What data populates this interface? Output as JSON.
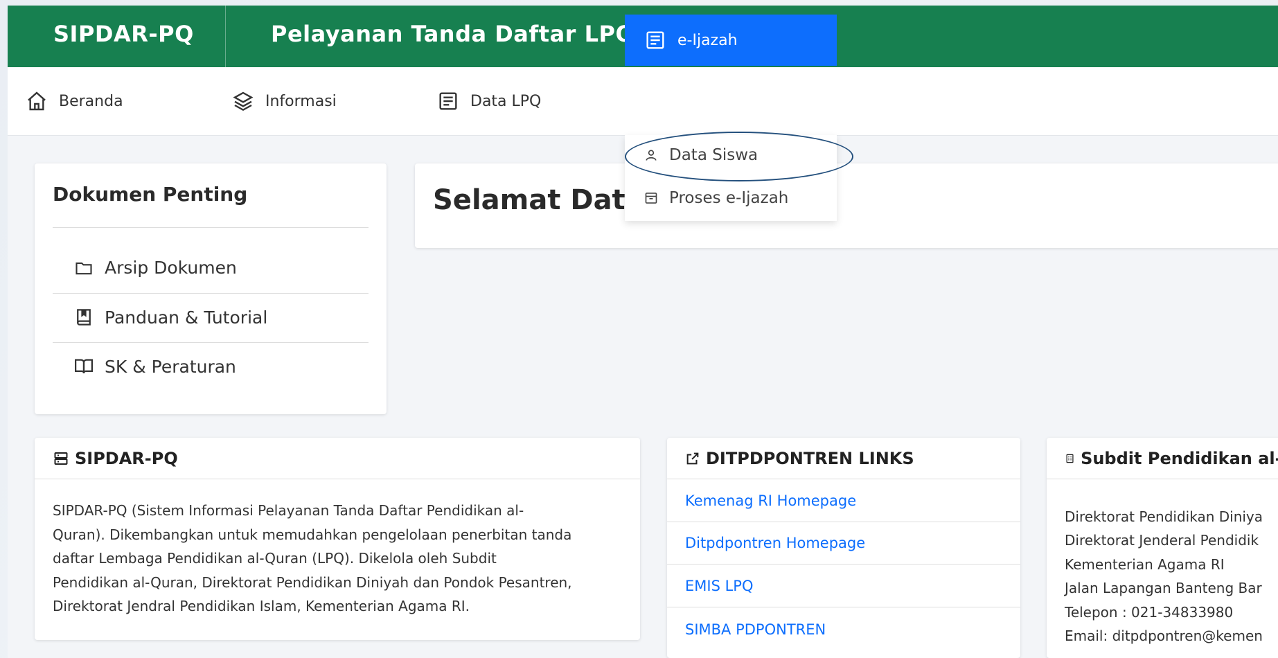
{
  "header": {
    "brand": "SIPDAR-PQ",
    "title": "Pelayanan Tanda Daftar LPQ"
  },
  "nav": {
    "beranda": "Beranda",
    "informasi": "Informasi",
    "data_lpq": "Data LPQ",
    "eijazah": "e-Ijazah"
  },
  "dropdown": {
    "items": [
      "Data Siswa",
      "Proses e-Ijazah"
    ]
  },
  "dokumen": {
    "title": "Dokumen Penting",
    "items": [
      "Arsip Dokumen",
      "Panduan & Tutorial",
      "SK & Peraturan"
    ]
  },
  "welcome": {
    "title": "Selamat Datang"
  },
  "about": {
    "title": "SIPDAR-PQ",
    "lines": [
      "SIPDAR-PQ (Sistem Informasi Pelayanan Tanda Daftar Pendidikan al-",
      "Quran). Dikembangkan untuk memudahkan pengelolaan penerbitan tanda",
      "daftar Lembaga Pendidikan al-Quran (LPQ). Dikelola oleh Subdit",
      "Pendidikan al-Quran, Direktorat Pendidikan Diniyah dan Pondok Pesantren,",
      "Direktorat Jendral Pendidikan Islam, Kementerian Agama RI."
    ]
  },
  "links": {
    "title": "DITPDPONTREN LINKS",
    "items": [
      "Kemenag RI Homepage",
      "Ditpdpontren Homepage",
      "EMIS LPQ",
      "SIMBA PDPONTREN"
    ]
  },
  "subdit": {
    "title": "Subdit Pendidikan al-Q",
    "lines": [
      "Direktorat Pendidikan Diniya",
      "Direktorat Jenderal Pendidik",
      "Kementerian Agama RI",
      "Jalan Lapangan Banteng Bar",
      "Telepon : 021-34833980",
      "Email: ditpdpontren@kemen"
    ]
  },
  "colors": {
    "primary_green": "#178050",
    "active_blue": "#0d6efd",
    "link_blue": "#0d6efd",
    "annotation": "#24507d"
  },
  "icons": {
    "beranda": "home-icon",
    "informasi": "layers-icon",
    "data_lpq": "document-list-icon",
    "eijazah": "document-list-icon",
    "data_siswa": "person-icon",
    "proses": "archive-icon",
    "arsip": "folder-icon",
    "panduan": "book-icon",
    "sk": "open-book-icon",
    "about": "server-icon",
    "links": "external-link-icon",
    "subdit": "building-icon"
  }
}
